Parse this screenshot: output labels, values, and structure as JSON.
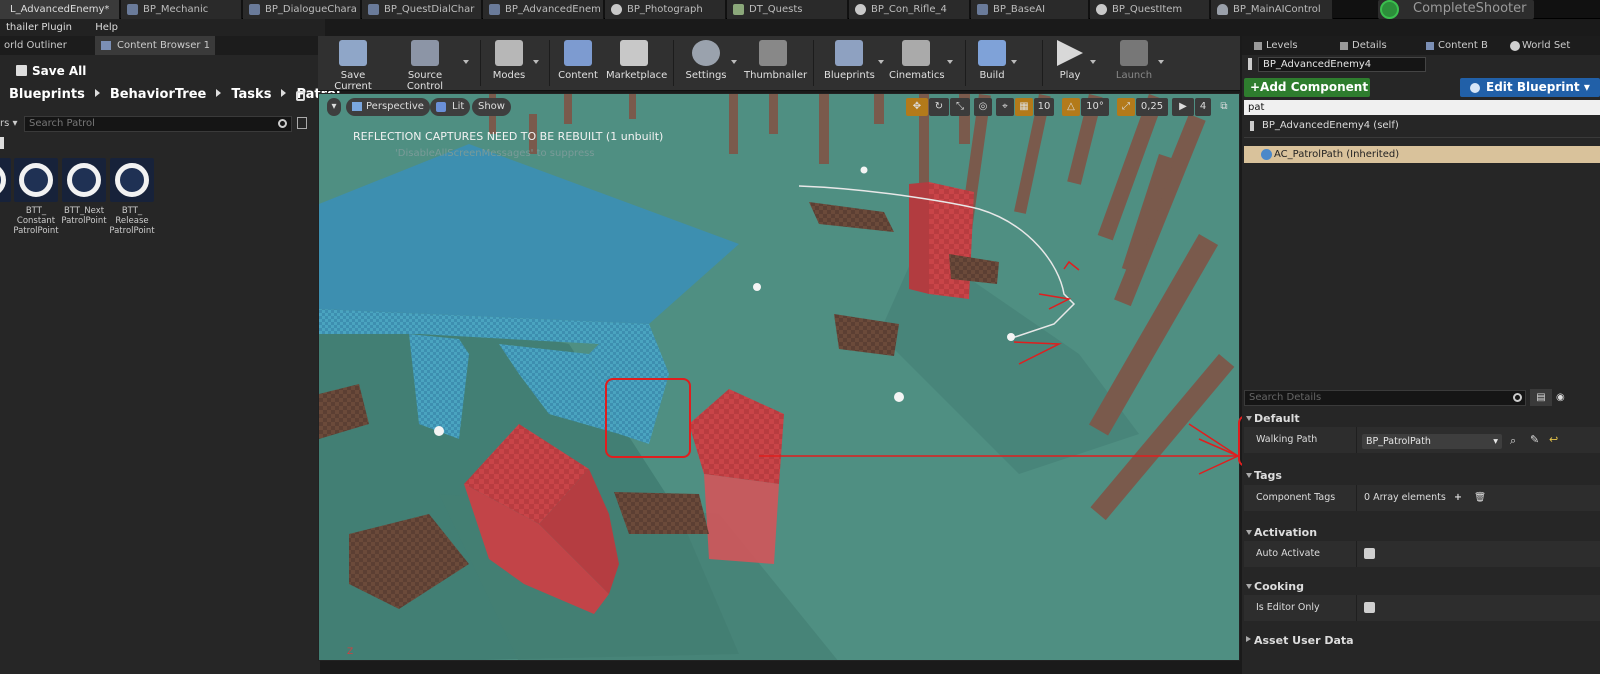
{
  "tabs": [
    {
      "label": "L_AdvancedEnemy*",
      "icon": "level-icon"
    },
    {
      "label": "BP_Mechanic",
      "icon": "blueprint-icon"
    },
    {
      "label": "BP_DialogueChara",
      "icon": "blueprint-icon"
    },
    {
      "label": "BP_QuestDialChar",
      "icon": "blueprint-icon"
    },
    {
      "label": "BP_AdvancedEnem",
      "icon": "blueprint-icon"
    },
    {
      "label": "BP_Photograph",
      "icon": "sphere-icon"
    },
    {
      "label": "DT_Quests",
      "icon": "datatable-icon"
    },
    {
      "label": "BP_Con_Rifle_4",
      "icon": "sphere-icon"
    },
    {
      "label": "BP_BaseAI",
      "icon": "blueprint-icon"
    },
    {
      "label": "BP_QuestItem",
      "icon": "sphere-icon"
    },
    {
      "label": "BP_MainAIControl",
      "icon": "controller-icon"
    }
  ],
  "project_name": "CompleteShooter",
  "menu": [
    "thailer Plugin",
    "Help"
  ],
  "left_tabs": [
    "orld Outliner",
    "Content Browser 1"
  ],
  "content_browser": {
    "save_all": "Save All",
    "breadcrumb": [
      "Blueprints",
      "BehaviorTree",
      "Tasks",
      "Patrol"
    ],
    "filters_label": "rs",
    "search_placeholder": "Search Patrol",
    "assets": [
      {
        "label": "rol"
      },
      {
        "label": "BTT_ Constant PatrolPoint"
      },
      {
        "label": "BTT_Next PatrolPoint"
      },
      {
        "label": "BTT_ Release PatrolPoint"
      }
    ]
  },
  "toolbar": [
    {
      "label": "Save Current",
      "color": "#8fa6c8"
    },
    {
      "label": "Source Control",
      "color": "#8c95a6"
    },
    {
      "label": "Modes",
      "color": "#b7b7b7"
    },
    {
      "label": "Content",
      "color": "#7d9bd0"
    },
    {
      "label": "Marketplace",
      "color": "#c8c8c8"
    },
    {
      "label": "Settings",
      "color": "#9aa2ad"
    },
    {
      "label": "Thumbnailer",
      "color": "#888888"
    },
    {
      "label": "Blueprints",
      "color": "#8ea1c1"
    },
    {
      "label": "Cinematics",
      "color": "#aaaaaa"
    },
    {
      "label": "Build",
      "color": "#7fa2d8"
    },
    {
      "label": "Play",
      "color": "#d8d8d8"
    },
    {
      "label": "Launch",
      "color": "#777777"
    }
  ],
  "viewport": {
    "view_mode": "Perspective",
    "lit": "Lit",
    "show": "Show",
    "reflection_message": "REFLECTION CAPTURES NEED TO BE REBUILT (1 unbuilt)",
    "suppress_message": "'DisableAllScreenMessages' to suppress",
    "grid_snap": "10",
    "rotation_snap": "10°",
    "scale_snap": "0,25",
    "camera_speed": "4"
  },
  "right_tabs": [
    "Levels",
    "Details",
    "Content B",
    "World Set"
  ],
  "details": {
    "blueprint_name": "BP_AdvancedEnemy4",
    "add_component": "+Add Component",
    "edit_blueprint": "Edit Blueprint",
    "component_search": "pat",
    "self_row": "BP_AdvancedEnemy4 (self)",
    "patrol_component": "AC_PatrolPath (Inherited)",
    "details_search_placeholder": "Search Details",
    "categories": {
      "default": "Default",
      "tags": "Tags",
      "activation": "Activation",
      "cooking": "Cooking",
      "asset_user_data": "Asset User Data"
    },
    "walking_path_label": "Walking Path",
    "walking_path_value": "BP_PatrolPath",
    "component_tags_label": "Component Tags",
    "component_tags_value": "0 Array elements",
    "auto_activate_label": "Auto Activate",
    "is_editor_only_label": "Is Editor Only"
  },
  "colors": {
    "ground": "#4f8f82",
    "red_block": "#c94448",
    "blue_block": "#3d8fb0",
    "annotation": "#e01e1e"
  }
}
